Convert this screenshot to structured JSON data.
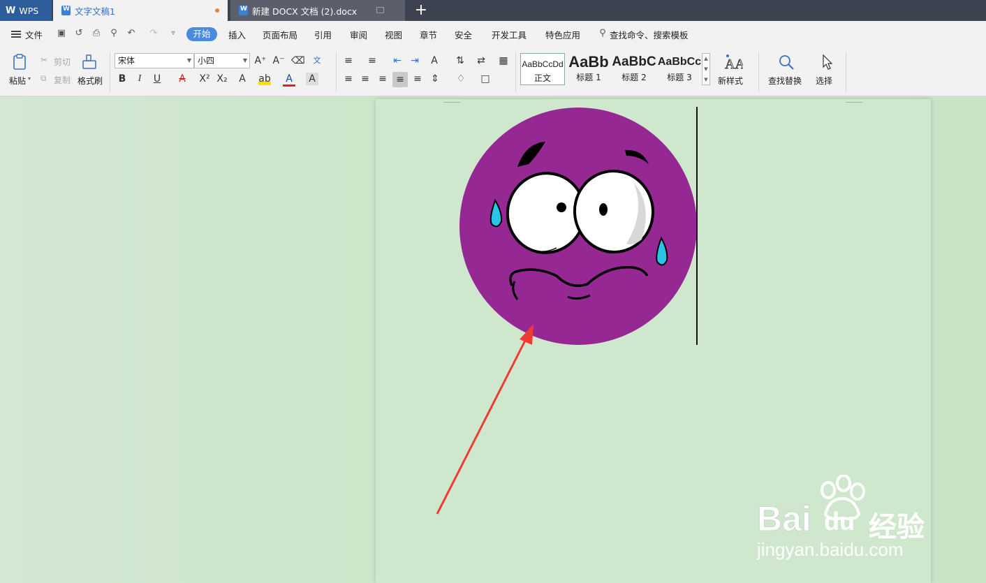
{
  "tabs": {
    "wps_label": "WPS",
    "active_doc": "文字文稿1",
    "other_doc": "新建 DOCX 文档 (2).docx"
  },
  "menu": {
    "file": "文件",
    "items": [
      "开始",
      "插入",
      "页面布局",
      "引用",
      "审阅",
      "视图",
      "章节",
      "安全",
      "开发工具",
      "特色应用"
    ],
    "search": "查找命令、搜索模板"
  },
  "ribbon": {
    "paste": "粘贴",
    "cut": "剪切",
    "copy": "复制",
    "format_painter": "格式刷",
    "font_name": "宋体",
    "font_size": "小四",
    "styles": [
      {
        "sample": "AaBbCcDd",
        "label": "正文"
      },
      {
        "sample": "AaBb",
        "label": "标题 1"
      },
      {
        "sample": "AaBbC",
        "label": "标题 2"
      },
      {
        "sample": "AaBbCc",
        "label": "标题 3"
      }
    ],
    "new_style": "新样式",
    "find_replace": "查找替换",
    "select": "选择"
  },
  "colors": {
    "face": "#952893",
    "arrow": "#f03a34",
    "accent": "#4a8be0"
  },
  "watermark": {
    "brand": "Bai",
    "du": "du",
    "cn": "经验",
    "url": "jingyan.baidu.com"
  }
}
